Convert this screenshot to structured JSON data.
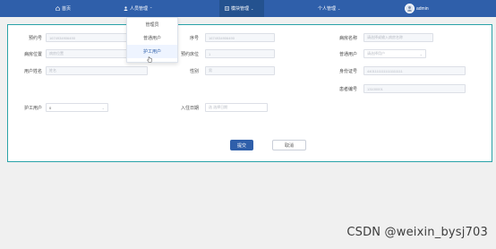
{
  "nav": {
    "home": "首页",
    "personnel": "人员管理",
    "module": "模块管理",
    "personal": "个人管理",
    "user": "admin"
  },
  "dropdown": {
    "items": [
      "管理员",
      "普通用户",
      "护工用户"
    ]
  },
  "form": {
    "row1": {
      "f1_label": "预约号",
      "f1_placeholder": "1674934906490",
      "f2_label": "序号",
      "f2_placeholder": "1674934906490",
      "f3_label": "病房名称",
      "f3_placeholder": "请选择或输入病房名称"
    },
    "row2": {
      "f1_label": "病房位置",
      "f1_placeholder": "病房位置",
      "f2_label": "预约床位",
      "f2_placeholder": "1",
      "f3_label": "普通用户",
      "f3_placeholder": "请选择用户"
    },
    "row3": {
      "f1_label": "用户姓名",
      "f1_placeholder": "姓名",
      "f2_label": "性别",
      "f2_placeholder": "男",
      "f3_label": "身份证号",
      "f3_placeholder": "44011111111111111111"
    },
    "row4": {
      "f3_label": "患者编号",
      "f3_placeholder": "13100001"
    },
    "row5": {
      "f1_label": "护工用户",
      "f1_value": "0",
      "f2_label": "入住日期",
      "f2_placeholder": "选 选择日期"
    },
    "submit": "提交",
    "cancel": "取消"
  },
  "watermark": "CSDN @weixin_bysj703",
  "colors": {
    "nav": "#2f5faa",
    "panel_border": "#2aa3a8",
    "primary": "#2f5faa"
  }
}
